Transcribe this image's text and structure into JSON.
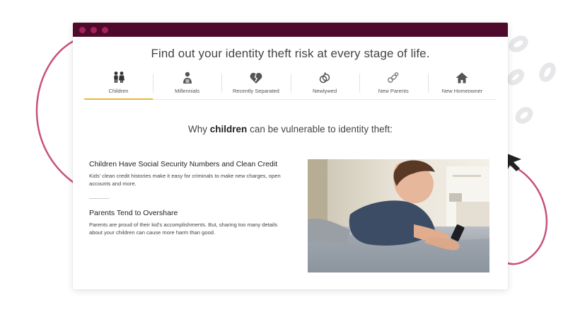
{
  "window": {
    "headline": "Find out your identity theft risk at every stage of life."
  },
  "tabs": [
    {
      "label": "Children",
      "icon": "children-icon",
      "active": true
    },
    {
      "label": "Millennials",
      "icon": "millennial-icon",
      "active": false
    },
    {
      "label": "Recently Separated",
      "icon": "broken-heart-icon",
      "active": false
    },
    {
      "label": "Newlywed",
      "icon": "rings-icon",
      "active": false
    },
    {
      "label": "New Parents",
      "icon": "pacifier-icon",
      "active": false
    },
    {
      "label": "New Homeowner",
      "icon": "house-icon",
      "active": false
    }
  ],
  "section": {
    "prefix": "Why ",
    "emphasis": "children",
    "suffix": " can be vulnerable to identity theft:"
  },
  "points": [
    {
      "title": "Children Have Social Security Numbers and Clean Credit",
      "body": "Kids’ clean credit histories make it easy for criminals to make new charges, open accounts and more."
    },
    {
      "title": "Parents Tend to Overshare",
      "body": "Parents are proud of their kid’s accomplishments. But, sharing too many details about your children can cause more harm than good."
    }
  ],
  "colors": {
    "titlebar": "#4f0a2b",
    "dots": "#a3225b",
    "accent_underline": "#e9b93a",
    "arc": "#c9507f"
  }
}
